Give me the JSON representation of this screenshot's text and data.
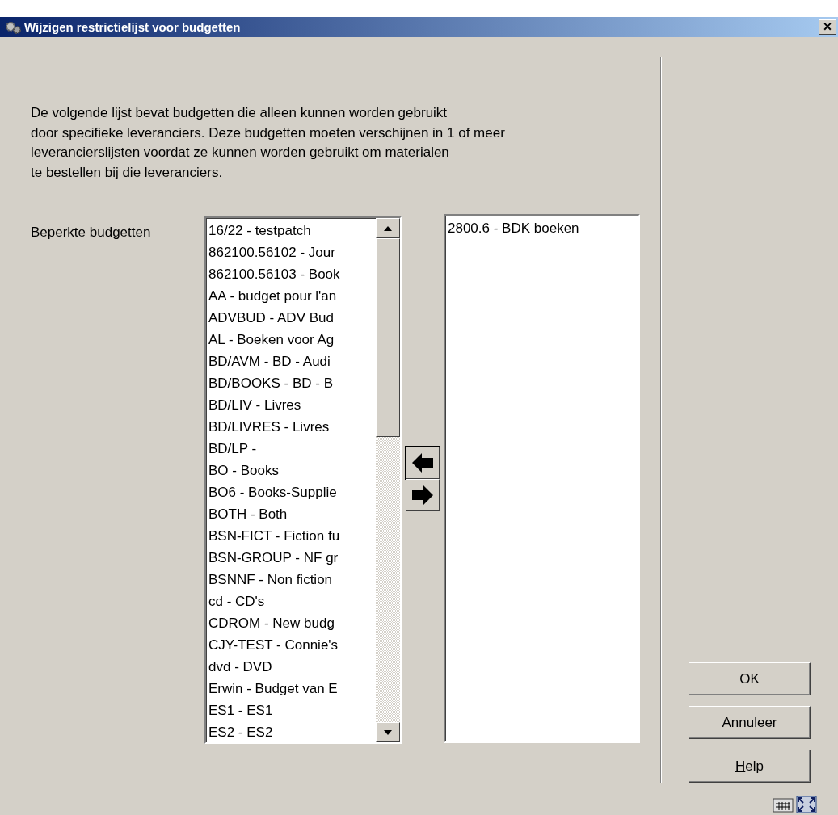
{
  "window": {
    "title": "Wijzigen restrictielijst voor budgetten",
    "close": "×"
  },
  "description_lines": [
    "De volgende lijst bevat budgetten die alleen kunnen worden gebruikt",
    "door specifieke leveranciers. Deze budgetten moeten verschijnen in 1 of meer",
    "leverancierslijsten voordat ze kunnen worden gebruikt om materialen",
    "te bestellen bij die leveranciers."
  ],
  "field_label": "Beperkte budgetten",
  "available_list": [
    "16/22 - testpatch",
    "862100.56102 - Jour",
    "862100.56103 - Book",
    "AA - budget pour l'an",
    "ADVBUD - ADV Bud",
    "AL - Boeken voor Ag",
    "BD/AVM - BD - Audi",
    "BD/BOOKS - BD - B",
    "BD/LIV - Livres",
    "BD/LIVRES - Livres",
    "BD/LP -",
    "BO - Books",
    "BO6 - Books-Supplie",
    "BOTH - Both",
    "BSN-FICT - Fiction fu",
    "BSN-GROUP - NF gr",
    "BSNNF - Non fiction",
    "cd - CD's",
    "CDROM - New budg",
    "CJY-TEST - Connie's",
    "dvd - DVD",
    "Erwin - Budget van E",
    "ES1 - ES1",
    "ES2 - ES2"
  ],
  "selected_list": [
    "2800.6 - BDK boeken"
  ],
  "buttons": [
    {
      "label": "OK",
      "mnemonic": false
    },
    {
      "label": "Annuleer",
      "mnemonic": false
    },
    {
      "label": "Help",
      "mnemonic": true
    }
  ]
}
